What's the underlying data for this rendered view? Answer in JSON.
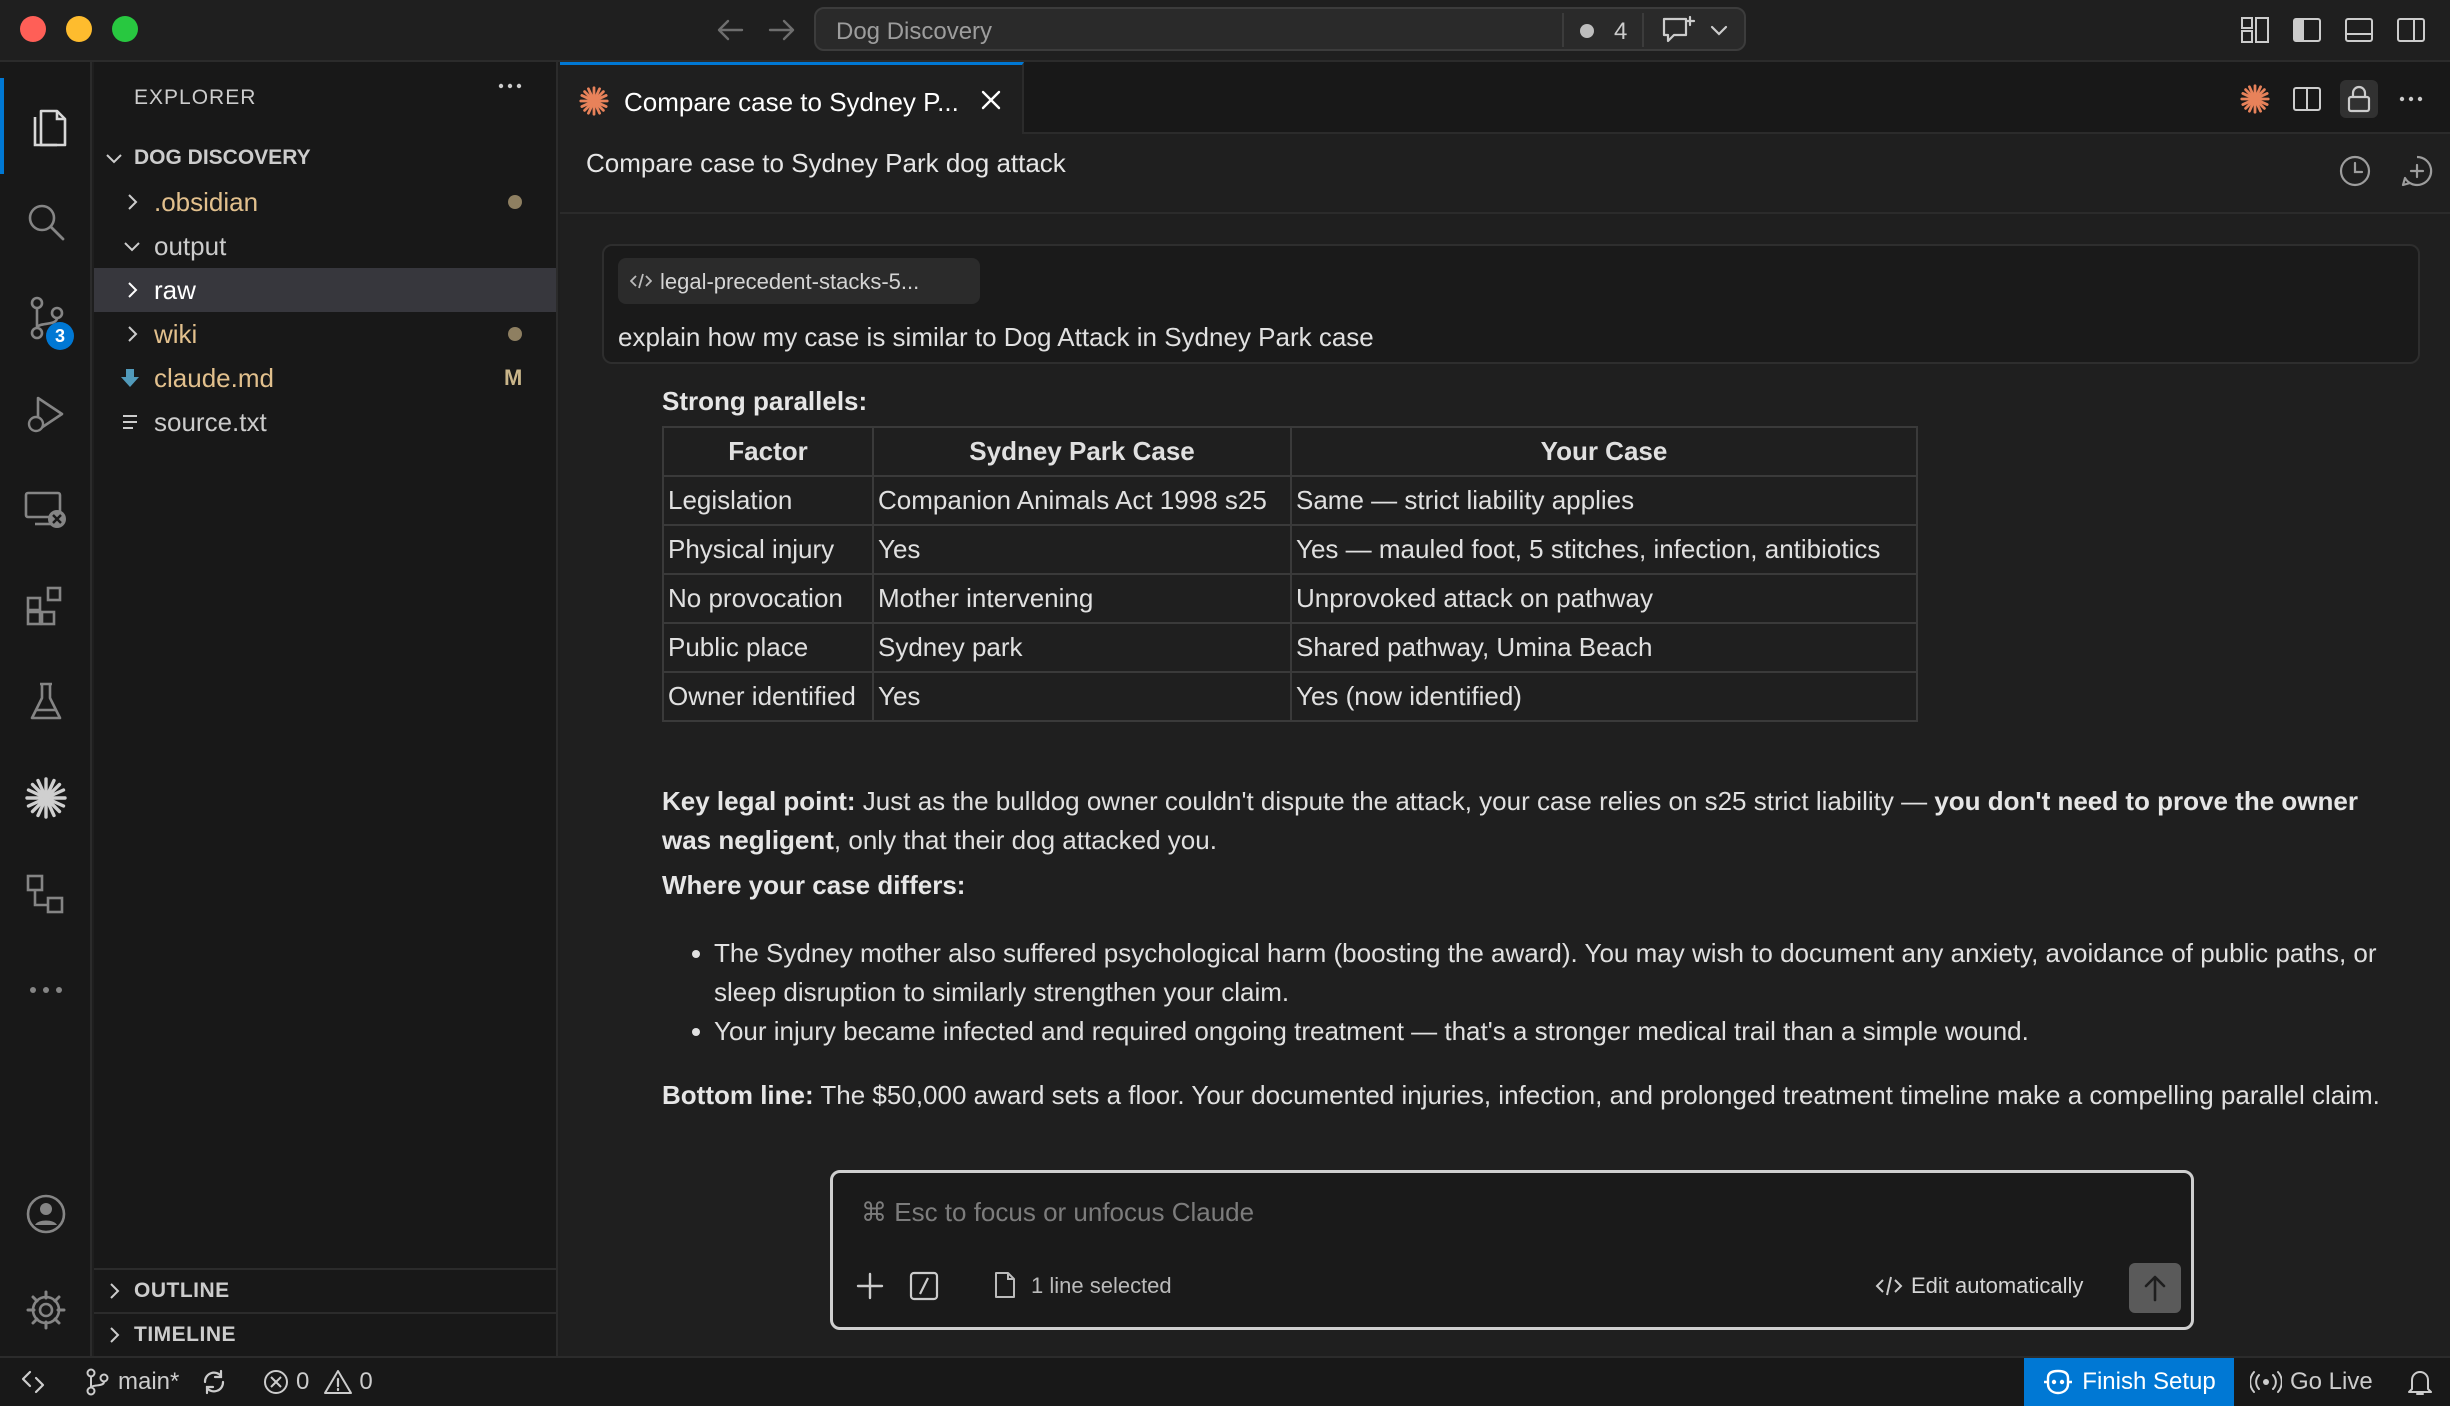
{
  "window": {
    "title": "Dog Discovery",
    "notification_count": "4"
  },
  "sidebar": {
    "header": "EXPLORER",
    "root": "DOG DISCOVERY",
    "items": [
      {
        "label": ".obsidian",
        "type": "folder",
        "expanded": false,
        "color": "#e2c08d",
        "modified_dot": true
      },
      {
        "label": "output",
        "type": "folder",
        "expanded": true,
        "color": "#cccccc"
      },
      {
        "label": "raw",
        "type": "folder",
        "expanded": false,
        "color": "#ffffff",
        "selected": true
      },
      {
        "label": "wiki",
        "type": "folder",
        "expanded": false,
        "color": "#e2c08d",
        "modified_dot": true
      },
      {
        "label": "claude.md",
        "type": "file",
        "icon": "markdown-download-icon",
        "color": "#e2c08d",
        "status": "M"
      },
      {
        "label": "source.txt",
        "type": "file",
        "icon": "text-lines-icon",
        "color": "#cccccc"
      }
    ],
    "sections": {
      "outline": "OUTLINE",
      "timeline": "TIMELINE"
    }
  },
  "editor": {
    "tab_label": "Compare case to Sydney P...",
    "chat_title": "Compare case to Sydney Park dog attack",
    "chip_label": "legal-precedent-stacks-5...",
    "prompt": "explain how my case is similar to Dog Attack in Sydney Park case",
    "input_placeholder": "⌘ Esc to focus or unfocus Claude",
    "selection_label": "1 line selected",
    "edit_mode_label": "Edit automatically"
  },
  "response": {
    "strong_title": "Strong parallels:",
    "table": {
      "headers": [
        "Factor",
        "Sydney Park Case",
        "Your Case"
      ],
      "rows": [
        [
          "Legislation",
          "Companion Animals Act 1998 s25",
          "Same — strict liability applies"
        ],
        [
          "Physical injury",
          "Yes",
          "Yes — mauled foot, 5 stitches, infection, antibiotics"
        ],
        [
          "No provocation",
          "Mother intervening",
          "Unprovoked attack on pathway"
        ],
        [
          "Public place",
          "Sydney park",
          "Shared pathway, Umina Beach"
        ],
        [
          "Owner identified",
          "Yes",
          "Yes (now identified)"
        ]
      ]
    },
    "key_point": {
      "label": "Key legal point:",
      "text1": " Just as the bulldog owner couldn't dispute the attack, your case relies on s25 strict liability — ",
      "bold": "you don't need to prove the owner was negligent",
      "text2": ", only that their dog attacked you."
    },
    "differs_title": "Where your case differs:",
    "bullets": [
      "The Sydney mother also suffered psychological harm (boosting the award). You may wish to document any anxiety, avoidance of public paths, or sleep disruption to similarly strengthen your claim.",
      "Your injury became infected and required ongoing treatment — that's a stronger medical trail than a simple wound."
    ],
    "bottom_line": {
      "label": "Bottom line:",
      "text": " The $50,000 award sets a floor. Your documented injuries, infection, and prolonged treatment timeline make a compelling parallel claim."
    }
  },
  "statusbar": {
    "branch": "main*",
    "errors": "0",
    "warnings": "0",
    "finish_setup": "Finish Setup",
    "go_live": "Go Live"
  },
  "colors": {
    "accent": "#0078d4",
    "claude_orange": "#e8825a",
    "modified_yellow": "#e2c08d"
  }
}
